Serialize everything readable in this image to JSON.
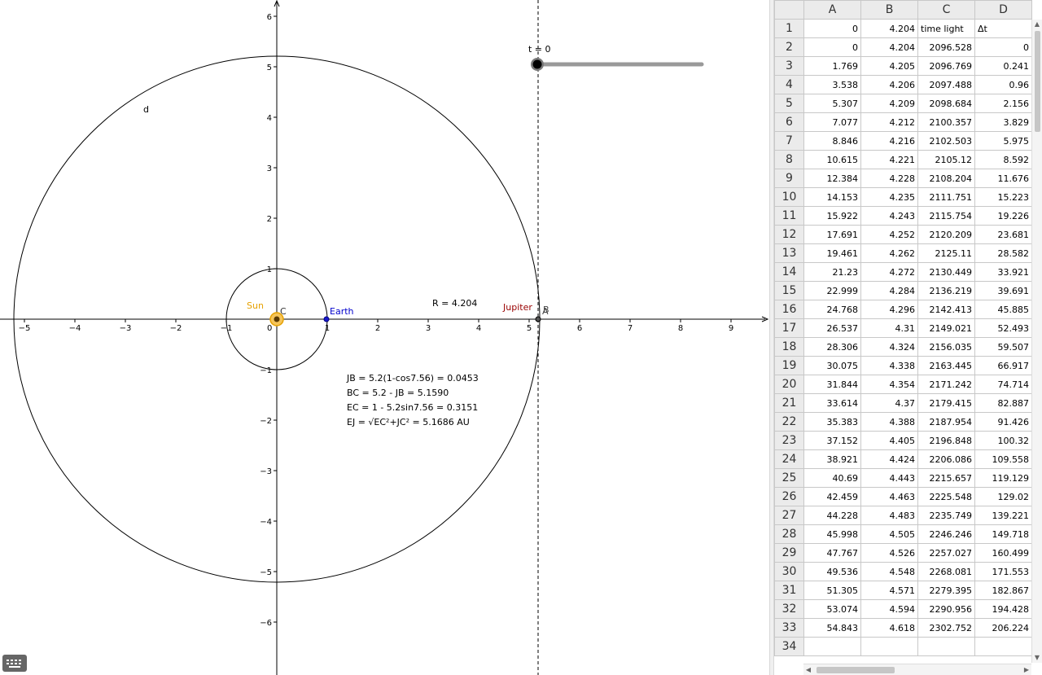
{
  "graphics": {
    "x_ticks": [
      "−5",
      "−4",
      "−3",
      "−2",
      "−1",
      "0",
      "1",
      "2",
      "3",
      "4",
      "5",
      "6",
      "7",
      "8",
      "9"
    ],
    "y_ticks": [
      "6",
      "5",
      "4",
      "3",
      "2",
      "1",
      "−1",
      "−2",
      "−3",
      "−4",
      "−5",
      "−6"
    ],
    "labels": {
      "d": "d",
      "sun": "Sun",
      "c": "C",
      "earth": "Earth",
      "jupiter": "Jupiter",
      "b": "B",
      "a": "A",
      "r_text": "R = 4.204"
    },
    "slider": {
      "label": "t = 0",
      "value": 0
    },
    "formulas": [
      "JB = 5.2(1-cos7.56) = 0.0453",
      "BC = 5.2 - JB = 5.1590",
      "EC = 1  - 5.2sin7.56 = 0.3151",
      "EJ = √EC²+JC² = 5.1686 AU"
    ],
    "colors": {
      "sun": "#e6a100",
      "earth": "#0000cc",
      "jupiter": "#990000"
    }
  },
  "spreadsheet": {
    "columns": [
      "A",
      "B",
      "C",
      "D"
    ],
    "rows": [
      {
        "n": "1",
        "a": "0",
        "b": "4.204",
        "c": "time light",
        "d": "Δt"
      },
      {
        "n": "2",
        "a": "0",
        "b": "4.204",
        "c": "2096.528",
        "d": "0"
      },
      {
        "n": "3",
        "a": "1.769",
        "b": "4.205",
        "c": "2096.769",
        "d": "0.241"
      },
      {
        "n": "4",
        "a": "3.538",
        "b": "4.206",
        "c": "2097.488",
        "d": "0.96"
      },
      {
        "n": "5",
        "a": "5.307",
        "b": "4.209",
        "c": "2098.684",
        "d": "2.156"
      },
      {
        "n": "6",
        "a": "7.077",
        "b": "4.212",
        "c": "2100.357",
        "d": "3.829"
      },
      {
        "n": "7",
        "a": "8.846",
        "b": "4.216",
        "c": "2102.503",
        "d": "5.975"
      },
      {
        "n": "8",
        "a": "10.615",
        "b": "4.221",
        "c": "2105.12",
        "d": "8.592"
      },
      {
        "n": "9",
        "a": "12.384",
        "b": "4.228",
        "c": "2108.204",
        "d": "11.676"
      },
      {
        "n": "10",
        "a": "14.153",
        "b": "4.235",
        "c": "2111.751",
        "d": "15.223"
      },
      {
        "n": "11",
        "a": "15.922",
        "b": "4.243",
        "c": "2115.754",
        "d": "19.226"
      },
      {
        "n": "12",
        "a": "17.691",
        "b": "4.252",
        "c": "2120.209",
        "d": "23.681"
      },
      {
        "n": "13",
        "a": "19.461",
        "b": "4.262",
        "c": "2125.11",
        "d": "28.582"
      },
      {
        "n": "14",
        "a": "21.23",
        "b": "4.272",
        "c": "2130.449",
        "d": "33.921"
      },
      {
        "n": "15",
        "a": "22.999",
        "b": "4.284",
        "c": "2136.219",
        "d": "39.691"
      },
      {
        "n": "16",
        "a": "24.768",
        "b": "4.296",
        "c": "2142.413",
        "d": "45.885"
      },
      {
        "n": "17",
        "a": "26.537",
        "b": "4.31",
        "c": "2149.021",
        "d": "52.493"
      },
      {
        "n": "18",
        "a": "28.306",
        "b": "4.324",
        "c": "2156.035",
        "d": "59.507"
      },
      {
        "n": "19",
        "a": "30.075",
        "b": "4.338",
        "c": "2163.445",
        "d": "66.917"
      },
      {
        "n": "20",
        "a": "31.844",
        "b": "4.354",
        "c": "2171.242",
        "d": "74.714"
      },
      {
        "n": "21",
        "a": "33.614",
        "b": "4.37",
        "c": "2179.415",
        "d": "82.887"
      },
      {
        "n": "22",
        "a": "35.383",
        "b": "4.388",
        "c": "2187.954",
        "d": "91.426"
      },
      {
        "n": "23",
        "a": "37.152",
        "b": "4.405",
        "c": "2196.848",
        "d": "100.32"
      },
      {
        "n": "24",
        "a": "38.921",
        "b": "4.424",
        "c": "2206.086",
        "d": "109.558"
      },
      {
        "n": "25",
        "a": "40.69",
        "b": "4.443",
        "c": "2215.657",
        "d": "119.129"
      },
      {
        "n": "26",
        "a": "42.459",
        "b": "4.463",
        "c": "2225.548",
        "d": "129.02"
      },
      {
        "n": "27",
        "a": "44.228",
        "b": "4.483",
        "c": "2235.749",
        "d": "139.221"
      },
      {
        "n": "28",
        "a": "45.998",
        "b": "4.505",
        "c": "2246.246",
        "d": "149.718"
      },
      {
        "n": "29",
        "a": "47.767",
        "b": "4.526",
        "c": "2257.027",
        "d": "160.499"
      },
      {
        "n": "30",
        "a": "49.536",
        "b": "4.548",
        "c": "2268.081",
        "d": "171.553"
      },
      {
        "n": "31",
        "a": "51.305",
        "b": "4.571",
        "c": "2279.395",
        "d": "182.867"
      },
      {
        "n": "32",
        "a": "53.074",
        "b": "4.594",
        "c": "2290.956",
        "d": "194.428"
      },
      {
        "n": "33",
        "a": "54.843",
        "b": "4.618",
        "c": "2302.752",
        "d": "206.224"
      },
      {
        "n": "34",
        "a": "",
        "b": "",
        "c": "",
        "d": ""
      }
    ]
  }
}
